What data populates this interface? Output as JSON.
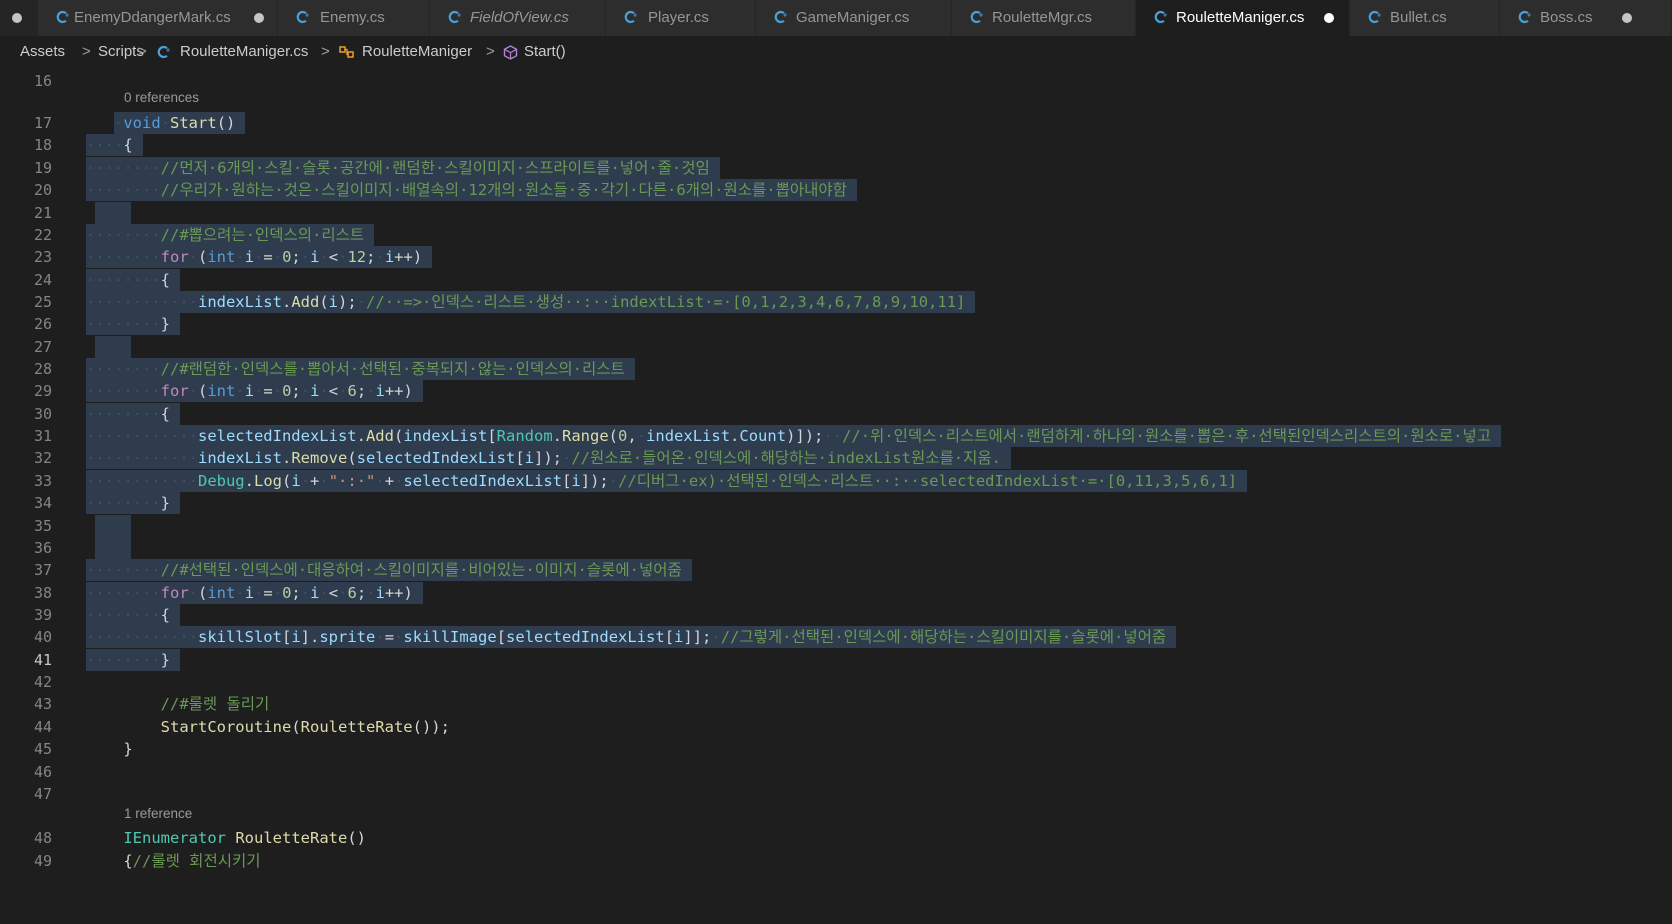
{
  "tabs": [
    {
      "label": "EnemyDdangerMark.cs",
      "dirty": true,
      "italic": false,
      "active": false
    },
    {
      "label": "Enemy.cs",
      "dirty": false,
      "italic": false,
      "active": false
    },
    {
      "label": "FieldOfView.cs",
      "dirty": false,
      "italic": true,
      "active": false
    },
    {
      "label": "Player.cs",
      "dirty": false,
      "italic": false,
      "active": false
    },
    {
      "label": "GameManiger.cs",
      "dirty": false,
      "italic": false,
      "active": false
    },
    {
      "label": "RouletteMgr.cs",
      "dirty": false,
      "italic": false,
      "active": false
    },
    {
      "label": "RouletteManiger.cs",
      "dirty": true,
      "italic": false,
      "active": true
    },
    {
      "label": "Bullet.cs",
      "dirty": false,
      "italic": false,
      "active": false
    },
    {
      "label": "Boss.cs",
      "dirty": true,
      "italic": false,
      "active": false
    }
  ],
  "breadcrumb": {
    "items": [
      "Assets",
      "Scripts",
      "RouletteManiger.cs",
      "RouletteManiger",
      "Start()"
    ],
    "separator": ">"
  },
  "editor": {
    "current_line": 41,
    "codelens": {
      "start": "0 references",
      "roulette_rate": "1 reference"
    },
    "lines": [
      {
        "no": 16,
        "selected": false,
        "tokens": []
      },
      {
        "no": 17,
        "selected": true,
        "tokens": [
          [
            "ws",
            "·"
          ],
          [
            "kw",
            "void"
          ],
          [
            "ws",
            "·"
          ],
          [
            "fn",
            "Start"
          ],
          [
            "plain",
            "()"
          ]
        ]
      },
      {
        "no": 18,
        "selected": true,
        "tokens": [
          [
            "ws",
            "····"
          ],
          [
            "plain",
            "{"
          ]
        ]
      },
      {
        "no": 19,
        "selected": true,
        "tokens": [
          [
            "ws",
            "········"
          ],
          [
            "cm",
            "//먼저·6개의·스킬·슬롯·공간에·랜덤한·스킬이미지·스프라이트를·넣어·줄·것임"
          ]
        ]
      },
      {
        "no": 20,
        "selected": true,
        "tokens": [
          [
            "ws",
            "········"
          ],
          [
            "cm",
            "//우리가·원하는·것은·스킬이미지·배열속의·12개의·원소들·중·각기·다른·6개의·원소를·뽑아내야함"
          ]
        ]
      },
      {
        "no": 21,
        "selected": true,
        "tokens": []
      },
      {
        "no": 22,
        "selected": true,
        "tokens": [
          [
            "ws",
            "········"
          ],
          [
            "cm",
            "//#뽑으려는·인덱스의·리스트"
          ]
        ]
      },
      {
        "no": 23,
        "selected": true,
        "tokens": [
          [
            "ws",
            "········"
          ],
          [
            "ctl",
            "for"
          ],
          [
            "ws",
            "·"
          ],
          [
            "plain",
            "("
          ],
          [
            "kw",
            "int"
          ],
          [
            "ws",
            "·"
          ],
          [
            "var",
            "i"
          ],
          [
            "ws",
            "·"
          ],
          [
            "plain",
            "="
          ],
          [
            "ws",
            "·"
          ],
          [
            "num",
            "0"
          ],
          [
            "plain",
            ";"
          ],
          [
            "ws",
            "·"
          ],
          [
            "var",
            "i"
          ],
          [
            "ws",
            "·"
          ],
          [
            "plain",
            "<"
          ],
          [
            "ws",
            "·"
          ],
          [
            "num",
            "12"
          ],
          [
            "plain",
            ";"
          ],
          [
            "ws",
            "·"
          ],
          [
            "var",
            "i"
          ],
          [
            "plain",
            "++)"
          ]
        ]
      },
      {
        "no": 24,
        "selected": true,
        "tokens": [
          [
            "ws",
            "········"
          ],
          [
            "plain",
            "{"
          ]
        ]
      },
      {
        "no": 25,
        "selected": true,
        "tokens": [
          [
            "ws",
            "············"
          ],
          [
            "var",
            "indexList"
          ],
          [
            "plain",
            "."
          ],
          [
            "fn",
            "Add"
          ],
          [
            "plain",
            "("
          ],
          [
            "var",
            "i"
          ],
          [
            "plain",
            ");"
          ],
          [
            "ws",
            "·"
          ],
          [
            "cm",
            "//··=>·인덱스·리스트·생성··:··indextList·=·[0,1,2,3,4,6,7,8,9,10,11]"
          ]
        ]
      },
      {
        "no": 26,
        "selected": true,
        "tokens": [
          [
            "ws",
            "········"
          ],
          [
            "plain",
            "}"
          ]
        ]
      },
      {
        "no": 27,
        "selected": true,
        "tokens": []
      },
      {
        "no": 28,
        "selected": true,
        "tokens": [
          [
            "ws",
            "········"
          ],
          [
            "cm",
            "//#랜덤한·인덱스를·뽑아서·선택된·중복되지·않는·인덱스의·리스트"
          ]
        ]
      },
      {
        "no": 29,
        "selected": true,
        "tokens": [
          [
            "ws",
            "········"
          ],
          [
            "ctl",
            "for"
          ],
          [
            "ws",
            "·"
          ],
          [
            "plain",
            "("
          ],
          [
            "kw",
            "int"
          ],
          [
            "ws",
            "·"
          ],
          [
            "var",
            "i"
          ],
          [
            "ws",
            "·"
          ],
          [
            "plain",
            "="
          ],
          [
            "ws",
            "·"
          ],
          [
            "num",
            "0"
          ],
          [
            "plain",
            ";"
          ],
          [
            "ws",
            "·"
          ],
          [
            "var",
            "i"
          ],
          [
            "ws",
            "·"
          ],
          [
            "plain",
            "<"
          ],
          [
            "ws",
            "·"
          ],
          [
            "num",
            "6"
          ],
          [
            "plain",
            ";"
          ],
          [
            "ws",
            "·"
          ],
          [
            "var",
            "i"
          ],
          [
            "plain",
            "++)"
          ]
        ]
      },
      {
        "no": 30,
        "selected": true,
        "tokens": [
          [
            "ws",
            "········"
          ],
          [
            "plain",
            "{"
          ]
        ]
      },
      {
        "no": 31,
        "selected": true,
        "tokens": [
          [
            "ws",
            "············"
          ],
          [
            "var",
            "selectedIndexList"
          ],
          [
            "plain",
            "."
          ],
          [
            "fn",
            "Add"
          ],
          [
            "plain",
            "("
          ],
          [
            "var",
            "indexList"
          ],
          [
            "plain",
            "["
          ],
          [
            "cls",
            "Random"
          ],
          [
            "plain",
            "."
          ],
          [
            "fn",
            "Range"
          ],
          [
            "plain",
            "("
          ],
          [
            "num",
            "0"
          ],
          [
            "plain",
            ","
          ],
          [
            "ws",
            "·"
          ],
          [
            "var",
            "indexList"
          ],
          [
            "plain",
            "."
          ],
          [
            "var",
            "Count"
          ],
          [
            "plain",
            ")]);"
          ],
          [
            "ws",
            "··"
          ],
          [
            "cm",
            "//·위·인덱스·리스트에서·랜덤하게·하나의·원소를·뽑은·후·선택된인덱스리스트의·원소로·넣고"
          ]
        ]
      },
      {
        "no": 32,
        "selected": true,
        "tokens": [
          [
            "ws",
            "············"
          ],
          [
            "var",
            "indexList"
          ],
          [
            "plain",
            "."
          ],
          [
            "fn",
            "Remove"
          ],
          [
            "plain",
            "("
          ],
          [
            "var",
            "selectedIndexList"
          ],
          [
            "plain",
            "["
          ],
          [
            "var",
            "i"
          ],
          [
            "plain",
            "]);"
          ],
          [
            "ws",
            "·"
          ],
          [
            "cm",
            "//원소로·들어온·인덱스에·해당하는·indexList원소를·지움."
          ]
        ]
      },
      {
        "no": 33,
        "selected": true,
        "tokens": [
          [
            "ws",
            "············"
          ],
          [
            "cls",
            "Debug"
          ],
          [
            "plain",
            "."
          ],
          [
            "fn",
            "Log"
          ],
          [
            "plain",
            "("
          ],
          [
            "var",
            "i"
          ],
          [
            "ws",
            "·"
          ],
          [
            "plain",
            "+"
          ],
          [
            "ws",
            "·"
          ],
          [
            "str",
            "\"·:·\""
          ],
          [
            "ws",
            "·"
          ],
          [
            "plain",
            "+"
          ],
          [
            "ws",
            "·"
          ],
          [
            "var",
            "selectedIndexList"
          ],
          [
            "plain",
            "["
          ],
          [
            "var",
            "i"
          ],
          [
            "plain",
            "]);"
          ],
          [
            "ws",
            "·"
          ],
          [
            "cm",
            "//디버그·ex)·선택된·인덱스·리스트··:··selectedIndexList·=·[0,11,3,5,6,1]"
          ]
        ]
      },
      {
        "no": 34,
        "selected": true,
        "tokens": [
          [
            "ws",
            "········"
          ],
          [
            "plain",
            "}"
          ]
        ]
      },
      {
        "no": 35,
        "selected": true,
        "tokens": []
      },
      {
        "no": 36,
        "selected": true,
        "tokens": []
      },
      {
        "no": 37,
        "selected": true,
        "tokens": [
          [
            "ws",
            "········"
          ],
          [
            "cm",
            "//#선택된·인덱스에·대응하여·스킬이미지를·비어있는·이미지·슬롯에·넣어줌"
          ]
        ]
      },
      {
        "no": 38,
        "selected": true,
        "tokens": [
          [
            "ws",
            "········"
          ],
          [
            "ctl",
            "for"
          ],
          [
            "ws",
            "·"
          ],
          [
            "plain",
            "("
          ],
          [
            "kw",
            "int"
          ],
          [
            "ws",
            "·"
          ],
          [
            "var",
            "i"
          ],
          [
            "ws",
            "·"
          ],
          [
            "plain",
            "="
          ],
          [
            "ws",
            "·"
          ],
          [
            "num",
            "0"
          ],
          [
            "plain",
            ";"
          ],
          [
            "ws",
            "·"
          ],
          [
            "var",
            "i"
          ],
          [
            "ws",
            "·"
          ],
          [
            "plain",
            "<"
          ],
          [
            "ws",
            "·"
          ],
          [
            "num",
            "6"
          ],
          [
            "plain",
            ";"
          ],
          [
            "ws",
            "·"
          ],
          [
            "var",
            "i"
          ],
          [
            "plain",
            "++)"
          ]
        ]
      },
      {
        "no": 39,
        "selected": true,
        "tokens": [
          [
            "ws",
            "········"
          ],
          [
            "plain",
            "{"
          ]
        ]
      },
      {
        "no": 40,
        "selected": true,
        "tokens": [
          [
            "ws",
            "············"
          ],
          [
            "var",
            "skillSlot"
          ],
          [
            "plain",
            "["
          ],
          [
            "var",
            "i"
          ],
          [
            "plain",
            "]."
          ],
          [
            "var",
            "sprite"
          ],
          [
            "ws",
            "·"
          ],
          [
            "plain",
            "="
          ],
          [
            "ws",
            "·"
          ],
          [
            "var",
            "skillImage"
          ],
          [
            "plain",
            "["
          ],
          [
            "var",
            "selectedIndexList"
          ],
          [
            "plain",
            "["
          ],
          [
            "var",
            "i"
          ],
          [
            "plain",
            "]];"
          ],
          [
            "ws",
            "·"
          ],
          [
            "cm",
            "//그렇게·선택된·인덱스에·해당하는·스킬이미지를·슬롯에·넣어줌"
          ]
        ]
      },
      {
        "no": 41,
        "selected": true,
        "tokens": [
          [
            "ws",
            "········"
          ],
          [
            "plain",
            "}"
          ]
        ]
      },
      {
        "no": 42,
        "selected": false,
        "tokens": []
      },
      {
        "no": 43,
        "selected": false,
        "tokens": [
          [
            "plain",
            "        "
          ],
          [
            "cm",
            "//#룰렛 돌리기"
          ]
        ]
      },
      {
        "no": 44,
        "selected": false,
        "tokens": [
          [
            "plain",
            "        "
          ],
          [
            "fn",
            "StartCoroutine"
          ],
          [
            "plain",
            "("
          ],
          [
            "fn",
            "RouletteRate"
          ],
          [
            "plain",
            "());"
          ]
        ]
      },
      {
        "no": 45,
        "selected": false,
        "tokens": [
          [
            "plain",
            "    }"
          ]
        ]
      },
      {
        "no": 46,
        "selected": false,
        "tokens": []
      },
      {
        "no": 47,
        "selected": false,
        "tokens": []
      },
      {
        "no": 48,
        "selected": false,
        "tokens": [
          [
            "plain",
            "    "
          ],
          [
            "cls",
            "IEnumerator"
          ],
          [
            "plain",
            " "
          ],
          [
            "fn",
            "RouletteRate"
          ],
          [
            "plain",
            "()"
          ]
        ]
      },
      {
        "no": 49,
        "selected": false,
        "tokens": [
          [
            "plain",
            "    {"
          ],
          [
            "cm",
            "//룰렛 회전시키기"
          ]
        ]
      }
    ]
  }
}
